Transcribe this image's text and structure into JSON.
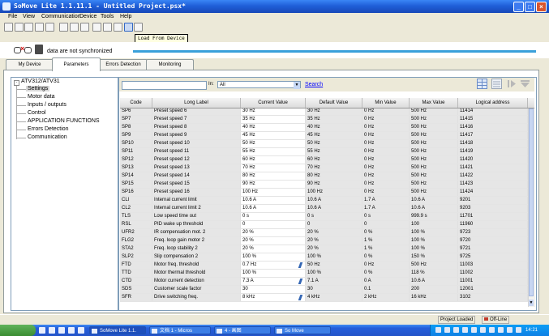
{
  "window": {
    "title": "SoMove Lite 1.1.11.1 - Untitled Project.psx*",
    "buttons": {
      "minimize": "_",
      "maximize": "□",
      "close": "×"
    }
  },
  "menu": [
    "File",
    "View",
    "Communication",
    "Device",
    "Tools",
    "Help"
  ],
  "toolbar": {
    "tooltip": "Load From Device"
  },
  "sync": {
    "text": "data are not synchronized"
  },
  "tabs": [
    "My Device",
    "Parameters",
    "Errors Detection",
    "Monitoring"
  ],
  "tree": {
    "root": "ATV312/ATV31",
    "expander": "-",
    "items": [
      "Settings",
      "Motor data",
      "Inputs / outputs",
      "Control",
      "APPLICATION FUNCTIONS",
      "Errors Detection",
      "Communication"
    ]
  },
  "search": {
    "in_label": "In:",
    "in_value": "All",
    "button": "Search",
    "dropdown_arrow": "▼"
  },
  "grid": {
    "headers": [
      "Code",
      "Long Label",
      "Current Value",
      "Default Value",
      "Min Value",
      "Max Value",
      "Logical address"
    ],
    "rows": [
      {
        "code": "SP6",
        "label": "Preset speed 6",
        "current": "30 Hz",
        "default": "30 Hz",
        "min": "0 Hz",
        "max": "500 Hz",
        "addr": "11414",
        "edit": false
      },
      {
        "code": "SP7",
        "label": "Preset speed 7",
        "current": "35 Hz",
        "default": "35 Hz",
        "min": "0 Hz",
        "max": "500 Hz",
        "addr": "11415",
        "edit": false
      },
      {
        "code": "SP8",
        "label": "Preset speed 8",
        "current": "40 Hz",
        "default": "40 Hz",
        "min": "0 Hz",
        "max": "500 Hz",
        "addr": "11416",
        "edit": false
      },
      {
        "code": "SP9",
        "label": "Preset speed 9",
        "current": "45 Hz",
        "default": "45 Hz",
        "min": "0 Hz",
        "max": "500 Hz",
        "addr": "11417",
        "edit": false
      },
      {
        "code": "SP10",
        "label": "Preset speed 10",
        "current": "50 Hz",
        "default": "50 Hz",
        "min": "0 Hz",
        "max": "500 Hz",
        "addr": "11418",
        "edit": false
      },
      {
        "code": "SP11",
        "label": "Preset speed 11",
        "current": "55 Hz",
        "default": "55 Hz",
        "min": "0 Hz",
        "max": "500 Hz",
        "addr": "11419",
        "edit": false
      },
      {
        "code": "SP12",
        "label": "Preset speed 12",
        "current": "60 Hz",
        "default": "60 Hz",
        "min": "0 Hz",
        "max": "500 Hz",
        "addr": "11420",
        "edit": false
      },
      {
        "code": "SP13",
        "label": "Preset speed 13",
        "current": "70 Hz",
        "default": "70 Hz",
        "min": "0 Hz",
        "max": "500 Hz",
        "addr": "11421",
        "edit": false
      },
      {
        "code": "SP14",
        "label": "Preset speed 14",
        "current": "80 Hz",
        "default": "80 Hz",
        "min": "0 Hz",
        "max": "500 Hz",
        "addr": "11422",
        "edit": false
      },
      {
        "code": "SP15",
        "label": "Preset speed 15",
        "current": "90 Hz",
        "default": "90 Hz",
        "min": "0 Hz",
        "max": "500 Hz",
        "addr": "11423",
        "edit": false
      },
      {
        "code": "SP16",
        "label": "Preset speed 16",
        "current": "100 Hz",
        "default": "100 Hz",
        "min": "0 Hz",
        "max": "500 Hz",
        "addr": "11424",
        "edit": false
      },
      {
        "code": "CLI",
        "label": "Internal current limit",
        "current": "10.6 A",
        "default": "10.6 A",
        "min": "1.7 A",
        "max": "10.6 A",
        "addr": "9201",
        "edit": false
      },
      {
        "code": "CL2",
        "label": "Internal current limit 2",
        "current": "10.6 A",
        "default": "10.6 A",
        "min": "1.7 A",
        "max": "10.6 A",
        "addr": "9203",
        "edit": false
      },
      {
        "code": "TLS",
        "label": "Low speed time out",
        "current": "0 s",
        "default": "0 s",
        "min": "0 s",
        "max": "999.9 s",
        "addr": "11701",
        "edit": false
      },
      {
        "code": "RSL",
        "label": "PID wake up threshold",
        "current": "0",
        "default": "0",
        "min": "0",
        "max": "100",
        "addr": "11960",
        "edit": false
      },
      {
        "code": "UFR2",
        "label": "IR compensation mot. 2",
        "current": "20 %",
        "default": "20 %",
        "min": "0 %",
        "max": "100 %",
        "addr": "9723",
        "edit": false
      },
      {
        "code": "FLG2",
        "label": "Freq. loop gain motor 2",
        "current": "20 %",
        "default": "20 %",
        "min": "1 %",
        "max": "100 %",
        "addr": "9720",
        "edit": false
      },
      {
        "code": "STA2",
        "label": "Freq. loop stability 2",
        "current": "20 %",
        "default": "20 %",
        "min": "1 %",
        "max": "100 %",
        "addr": "9721",
        "edit": false
      },
      {
        "code": "SLP2",
        "label": "Slip compensation 2",
        "current": "100 %",
        "default": "100 %",
        "min": "0 %",
        "max": "150 %",
        "addr": "9725",
        "edit": false
      },
      {
        "code": "FTD",
        "label": "Motor freq. threshold",
        "current": "0.7 Hz",
        "default": "50 Hz",
        "min": "0 Hz",
        "max": "500 Hz",
        "addr": "11003",
        "edit": true
      },
      {
        "code": "TTD",
        "label": "Motor thermal threshold",
        "current": "100 %",
        "default": "100 %",
        "min": "0 %",
        "max": "118 %",
        "addr": "11002",
        "edit": false
      },
      {
        "code": "CTD",
        "label": "Motor current detection",
        "current": "7.3 A",
        "default": "7.1 A",
        "min": "0 A",
        "max": "10.6 A",
        "addr": "11001",
        "edit": true
      },
      {
        "code": "SDS",
        "label": "Customer scale factor",
        "current": "30",
        "default": "30",
        "min": "0.1",
        "max": "200",
        "addr": "12001",
        "edit": false
      },
      {
        "code": "SFR",
        "label": "Drive switching freq.",
        "current": "8 kHz",
        "default": "4 kHz",
        "min": "2 kHz",
        "max": "16 kHz",
        "addr": "3102",
        "edit": true
      }
    ]
  },
  "status": {
    "loaded": "Project Loaded",
    "offline": "Off-Line"
  },
  "taskbar": {
    "tasks": [
      "SoMove Lite 1.1.",
      "文档 1 - Micros",
      "4 - 画图",
      "So Move"
    ],
    "clock": "14:21"
  },
  "colors": {
    "title_blue": "#245edb",
    "sync_bar": "#3aa0da",
    "link": "#0000ff"
  }
}
